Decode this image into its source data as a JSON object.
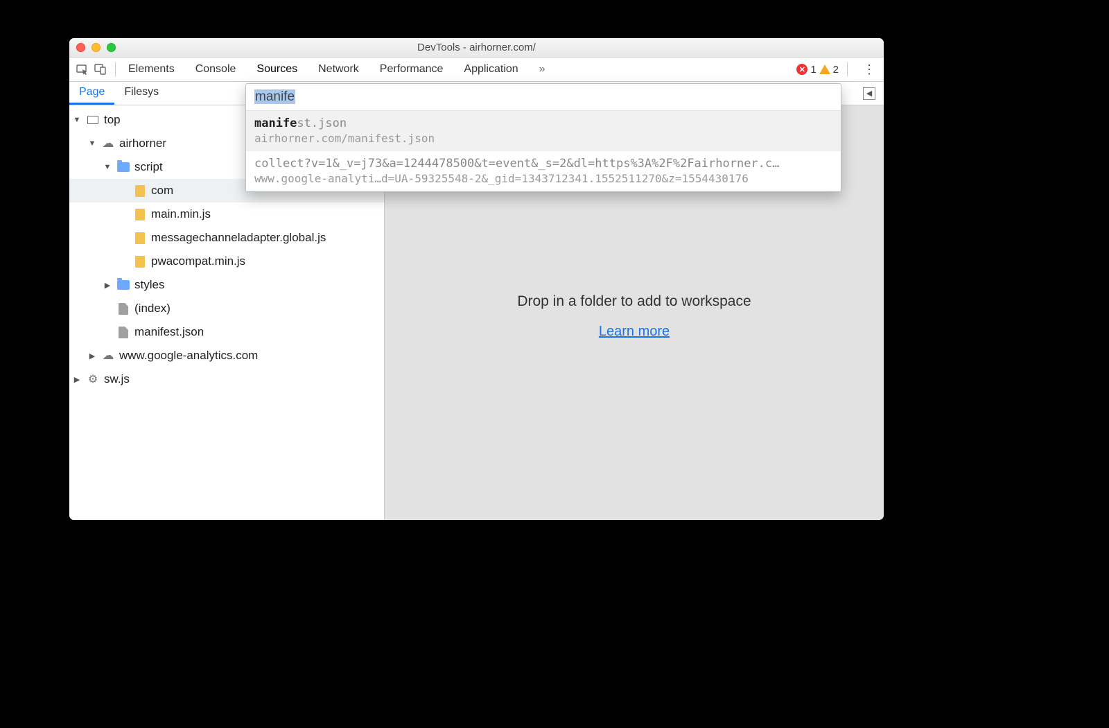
{
  "window": {
    "title": "DevTools - airhorner.com/"
  },
  "toolbar": {
    "tabs": [
      "Elements",
      "Console",
      "Sources",
      "Network",
      "Performance",
      "Application"
    ],
    "active_tab": "Sources",
    "error_count": "1",
    "warning_count": "2"
  },
  "subtabs": {
    "items": [
      "Page",
      "Filesys"
    ],
    "active": "Page"
  },
  "tree": {
    "top": "top",
    "domain1": "airhorner",
    "folder_scripts": "script",
    "file_truncated": "com",
    "file_main": "main.min.js",
    "file_mca": "messagechanneladapter.global.js",
    "file_pwa": "pwacompat.min.js",
    "folder_styles": "styles",
    "file_index": "(index)",
    "file_manifest": "manifest.json",
    "domain2": "www.google-analytics.com",
    "sw": "sw.js"
  },
  "workspace": {
    "message": "Drop in a folder to add to workspace",
    "link": "Learn more"
  },
  "quickopen": {
    "query": "manife",
    "results": [
      {
        "match_bold": "manife",
        "match_rest": "st.json",
        "path": "airhorner.com/manifest.json"
      },
      {
        "match_bold": "",
        "match_rest": "collect?v=1&_v=j73&a=1244478500&t=event&_s=2&dl=https%3A%2F%2Fairhorner.c…",
        "path": "www.google-analyti…d=UA-59325548-2&_gid=1343712341.1552511270&z=1554430176"
      }
    ]
  }
}
